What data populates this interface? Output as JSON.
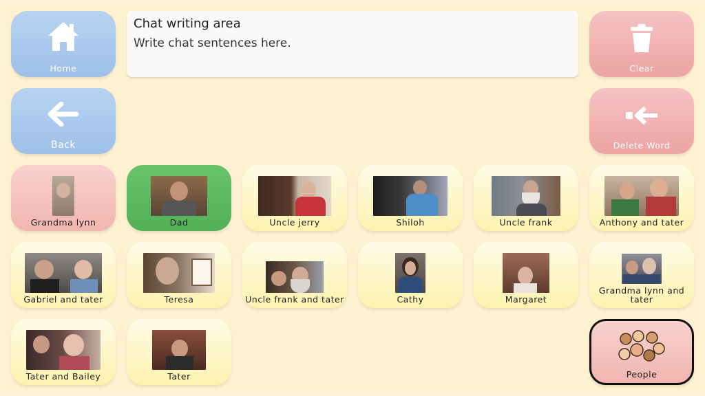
{
  "nav": {
    "home_label": "Home",
    "back_label": "Back",
    "clear_label": "Clear",
    "delete_word_label": "Delete Word",
    "people_label": "People"
  },
  "chat": {
    "title": "Chat writing area",
    "placeholder": "Write chat sentences here."
  },
  "people": [
    {
      "name": "Grandma lynn",
      "color": "#f4bfbc"
    },
    {
      "name": "Dad",
      "color": "#5cb862"
    },
    {
      "name": "Uncle jerry",
      "color": "#fdf6c6"
    },
    {
      "name": "Shiloh",
      "color": "#fdf6c6"
    },
    {
      "name": "Uncle frank",
      "color": "#fdf6c6"
    },
    {
      "name": "Anthony and tater",
      "color": "#fdf6c6"
    },
    {
      "name": "Gabriel and tater",
      "color": "#fdf6c6"
    },
    {
      "name": "Teresa",
      "color": "#fdf6c6"
    },
    {
      "name": "Uncle frank and tater",
      "color": "#fdf6c6"
    },
    {
      "name": "Cathy",
      "color": "#fdf6c6"
    },
    {
      "name": "Margaret",
      "color": "#fdf6c6"
    },
    {
      "name": "Grandma lynn and tater",
      "color": "#fdf6c6"
    },
    {
      "name": "Tater and Bailey",
      "color": "#fdf6c6"
    },
    {
      "name": "Tater",
      "color": "#fdf6c6"
    }
  ],
  "icons": {
    "home": "home-icon",
    "back": "arrow-left-icon",
    "clear": "trash-icon",
    "delete_word": "backspace-icon",
    "people": "people-icon"
  }
}
